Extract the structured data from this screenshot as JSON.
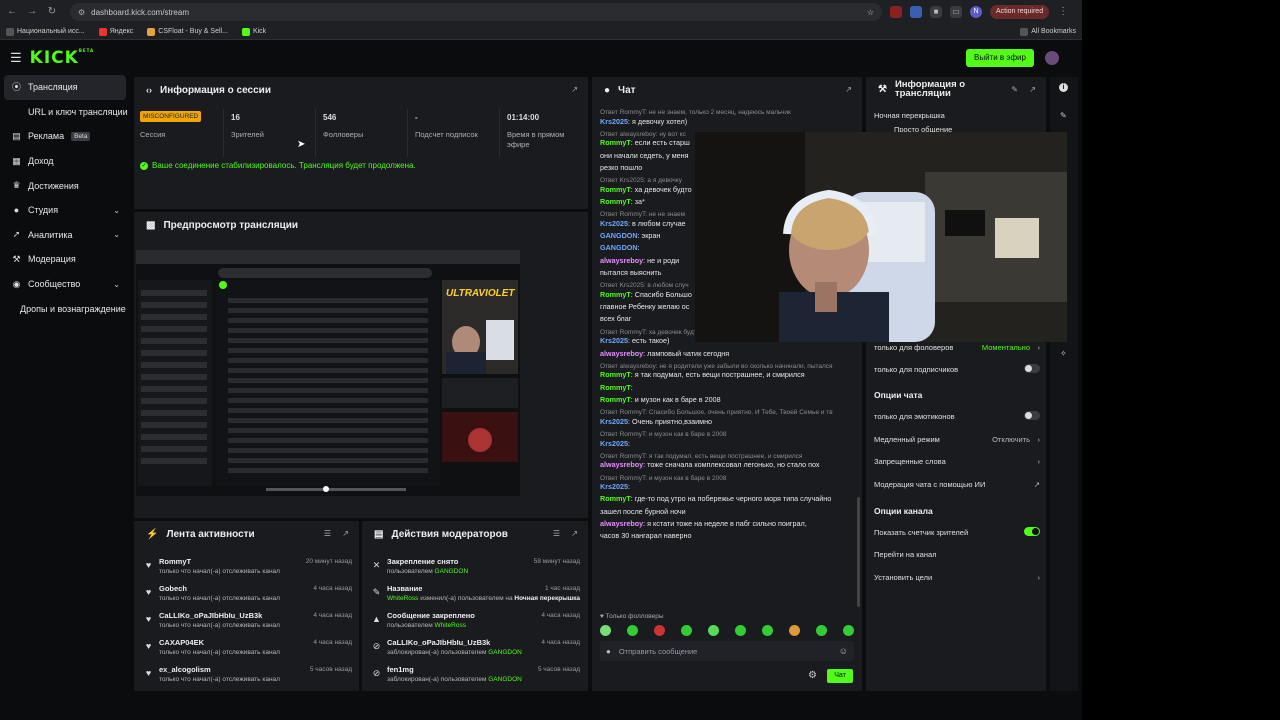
{
  "browser": {
    "url": "dashboard.kick.com/stream",
    "profile_initial": "N",
    "action_required": "Action required",
    "bookmarks": [
      "Национальный исс...",
      "Яндекс",
      "CSFloat - Buy & Sell...",
      "Kick"
    ],
    "all_bookmarks": "All Bookmarks"
  },
  "header": {
    "logo": "KICK",
    "logo_badge": "BETA",
    "go_live": "Выйти в эфир"
  },
  "sidebar": {
    "items": [
      {
        "label": "Трансляция",
        "icon": "broadcast-icon"
      },
      {
        "label": "URL и ключ трансляции",
        "icon": "link-icon"
      },
      {
        "label": "Реклама",
        "icon": "ad-icon",
        "badge": "Beta"
      },
      {
        "label": "Доход",
        "icon": "income-icon"
      },
      {
        "label": "Достижения",
        "icon": "trophy-icon"
      },
      {
        "label": "Студия",
        "icon": "studio-icon"
      },
      {
        "label": "Аналитика",
        "icon": "analytics-icon"
      },
      {
        "label": "Модерация",
        "icon": "moderation-icon"
      },
      {
        "label": "Сообщество",
        "icon": "community-icon"
      },
      {
        "label": "Дропы и вознаграждение",
        "icon": ""
      }
    ]
  },
  "session": {
    "title": "Информация о сессии",
    "status_badge": "MISCONFIGURED",
    "status_label": "Сессия",
    "stats": [
      {
        "value": "16",
        "label": "Зрителей"
      },
      {
        "value": "546",
        "label": "Фолловеры"
      },
      {
        "value": "-",
        "label": "Подсчет подписок"
      },
      {
        "value": "01:14:00",
        "label": "Время в прямом эфире"
      }
    ],
    "stabilized": "Ваше соединение стабилизировалось. Трансляция будет продолжена."
  },
  "preview": {
    "title": "Предпросмотр трансляции",
    "banner_text": "ULTRAVIOLET"
  },
  "activity": {
    "title": "Лента активности",
    "items": [
      {
        "name": "RommyT",
        "sub": "только что начал(-а) отслеживать канал",
        "time": "20 минут назад"
      },
      {
        "name": "Gobech",
        "sub": "только что начал(-а) отслеживать канал",
        "time": "4 часа назад"
      },
      {
        "name": "CaLLIKo_oPaJIbHbIu_UzB3k",
        "sub": "только что начал(-а) отслеживать канал",
        "time": "4 часа назад"
      },
      {
        "name": "CAXAP04EK",
        "sub": "только что начал(-а) отслеживать канал",
        "time": "4 часа назад"
      },
      {
        "name": "ex_alcogolism",
        "sub": "только что начал(-а) отслеживать канал",
        "time": "5 часов назад"
      }
    ]
  },
  "modactions": {
    "title": "Действия модераторов",
    "items": [
      {
        "name": "Закрепление снято",
        "sub": "пользователем",
        "who": "GANGDON",
        "extra": "",
        "time": "58 минут назад",
        "icon": "unpin-icon"
      },
      {
        "name": "Название",
        "sub": "изменил(-а) пользователем на",
        "who": "WhiteRoss",
        "extra": "Ночная перекрышка",
        "time": "1 час назад",
        "icon": "title-icon"
      },
      {
        "name": "Сообщение закреплено",
        "sub": "пользователем",
        "who": "WhiteRoss",
        "extra": "",
        "time": "4 часа назад",
        "icon": "pin-icon"
      },
      {
        "name": "CaLLIKo_oPaJIbHbIu_UzB3k",
        "sub": "заблокирован(-а) пользователем",
        "who": "GANGDON",
        "extra": "",
        "time": "4 часа назад",
        "icon": "ban-icon"
      },
      {
        "name": "fen1mg",
        "sub": "заблокирован(-а) пользователем",
        "who": "GANGDON",
        "extra": "",
        "time": "5 часов назад",
        "icon": "ban-icon"
      }
    ]
  },
  "chat": {
    "title": "Чат",
    "messages": [
      {
        "reply": "Ответ RommyT: не не знаем, только 2 месяц, надеюсь мальчик",
        "user": "",
        "text": ""
      },
      {
        "reply": "",
        "user": "Krs2025",
        "text": "я девочку хотел)"
      },
      {
        "reply": "Ответ alwaysreboy: ну вот кс",
        "user": "",
        "text": ""
      },
      {
        "reply": "",
        "user": "RommyT",
        "text": "если есть старш"
      },
      {
        "reply": "",
        "user": "",
        "text": "они начали седеть, у меня"
      },
      {
        "reply": "",
        "user": "",
        "text": "резко пошло"
      },
      {
        "reply": "Ответ Krs2025: а я девочку",
        "user": "",
        "text": ""
      },
      {
        "reply": "",
        "user": "RommyT",
        "text": "ха девочек будто"
      },
      {
        "reply": "",
        "user": "RommyT",
        "text": "за*"
      },
      {
        "reply": "Ответ RommyT: не не знаем",
        "user": "",
        "text": ""
      },
      {
        "reply": "",
        "user": "Krs2025",
        "text": "в любом случае"
      },
      {
        "reply": "",
        "user": "GANGDON",
        "text": "экран"
      },
      {
        "reply": "",
        "user": "GANGDON",
        "text": ""
      },
      {
        "reply": "",
        "user": "alwaysreboy",
        "text": "не и роди"
      },
      {
        "reply": "",
        "user": "",
        "text": "пытался выяснить"
      },
      {
        "reply": "Ответ Krs2025: в любом случ",
        "user": "",
        "text": ""
      },
      {
        "reply": "",
        "user": "RommyT",
        "text": "Спасибо Большо"
      },
      {
        "reply": "",
        "user": "",
        "text": "главное Ребенку желаю ос"
      },
      {
        "reply": "",
        "user": "",
        "text": "всех благ"
      },
      {
        "reply": "Ответ RommyT: ха девочек будто переживать в разы больше надо",
        "user": "",
        "text": ""
      },
      {
        "reply": "",
        "user": "Krs2025",
        "text": "есть такое)"
      },
      {
        "reply": "",
        "user": "alwaysreboy",
        "text": "ламповый чатик сегодня"
      },
      {
        "reply": "Ответ alwaysreboy: не я родители уже забыли во сколько начинали, пытался",
        "user": "",
        "text": ""
      },
      {
        "reply": "",
        "user": "RommyT",
        "text": "я так подумал, есть вещи пострашнее, и смирился"
      },
      {
        "reply": "",
        "user": "RommyT",
        "text": ""
      },
      {
        "reply": "",
        "user": "RommyT",
        "text": "и музон как в баре в 2008"
      },
      {
        "reply": "Ответ RommyT: Спасибо Большое, очень приятно. И Тебе, Твоей Семье и тв",
        "user": "",
        "text": ""
      },
      {
        "reply": "",
        "user": "Krs2025",
        "text": "Очень приятно,взаимно"
      },
      {
        "reply": "Ответ RommyT: и музон как в баре в 2008",
        "user": "",
        "text": ""
      },
      {
        "reply": "",
        "user": "Krs2025",
        "text": ""
      },
      {
        "reply": "Ответ RommyT: я так подумал, есть вещи пострашнее, и смирился",
        "user": "",
        "text": ""
      },
      {
        "reply": "",
        "user": "alwaysreboy",
        "text": "тоже сначала комплексовал легонько, но стало пох"
      },
      {
        "reply": "Ответ RommyT: и музон как в баре в 2008",
        "user": "",
        "text": ""
      },
      {
        "reply": "",
        "user": "Krs2025",
        "text": ""
      },
      {
        "reply": "",
        "user": "RommyT",
        "text": "где-то под утро на побережье черного моря типа случайно"
      },
      {
        "reply": "",
        "user": "",
        "text": "зашел после бурной ночи"
      },
      {
        "reply": "",
        "user": "alwaysreboy",
        "text": "я кстати тоже на неделе в пабг сильно поиграл,"
      },
      {
        "reply": "",
        "user": "",
        "text": "часов 30 нангарал наверно"
      }
    ],
    "followers_only": "Только фолловеры",
    "input_placeholder": "Отправить сообщение",
    "send": "Чат"
  },
  "info": {
    "title": "Информация о трансляции",
    "stream_title": "Ночная перекрышка",
    "category": "Просто общение",
    "followers_only_label": "только для фоловеров",
    "followers_only_value": "Моментально",
    "subs_only": "только для подписчиков",
    "chat_options": "Опции чата",
    "emotes_only": "только для эмотиконов",
    "slow_mode": "Медленный режим",
    "slow_mode_value": "Отключить",
    "banned_words": "Запрещенные слова",
    "ai_moderation": "Модерация чата с помощью ИИ",
    "channel_options": "Опции канала",
    "show_viewers": "Показать счетчик зрителей",
    "goto_channel": "Перейти на канал",
    "set_goals": "Установить цели"
  }
}
